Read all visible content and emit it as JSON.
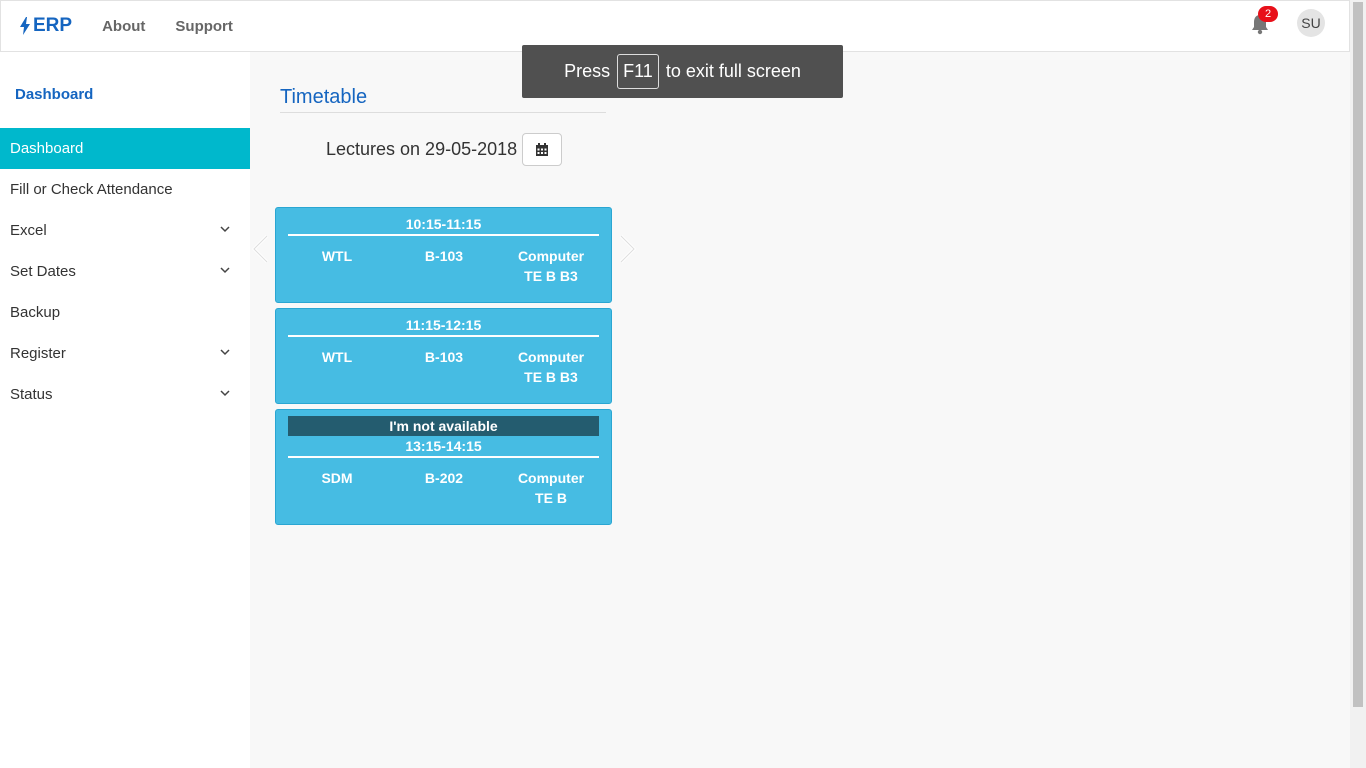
{
  "navbar": {
    "brand": "ERP",
    "links": [
      "About",
      "Support"
    ],
    "notification_count": "2",
    "avatar_initials": "SU"
  },
  "sidebar": {
    "title": "Dashboard",
    "items": [
      {
        "label": "Dashboard",
        "active": true,
        "expandable": false
      },
      {
        "label": "Fill or Check Attendance",
        "active": false,
        "expandable": false
      },
      {
        "label": "Excel",
        "active": false,
        "expandable": true
      },
      {
        "label": "Set Dates",
        "active": false,
        "expandable": true
      },
      {
        "label": "Backup",
        "active": false,
        "expandable": false
      },
      {
        "label": "Register",
        "active": false,
        "expandable": true
      },
      {
        "label": "Status",
        "active": false,
        "expandable": true
      }
    ]
  },
  "main": {
    "title": "Timetable",
    "lectures_label": "Lectures on 29-05-2018",
    "cards": [
      {
        "time": "10:15-11:15",
        "subject": "WTL",
        "room": "B-103",
        "dept": "Computer",
        "class": "TE B B3",
        "not_available": ""
      },
      {
        "time": "11:15-12:15",
        "subject": "WTL",
        "room": "B-103",
        "dept": "Computer",
        "class": "TE B B3",
        "not_available": ""
      },
      {
        "time": "13:15-14:15",
        "subject": "SDM",
        "room": "B-202",
        "dept": "Computer",
        "class": "TE B",
        "not_available": "I'm not available"
      }
    ]
  },
  "toast": {
    "prefix": "Press",
    "key": "F11",
    "suffix": "to exit full screen"
  },
  "colors": {
    "accent": "#00b8cc",
    "brand": "#1565c0",
    "card": "#46bce3",
    "banner": "#245c6f",
    "badge": "#e8101a"
  }
}
